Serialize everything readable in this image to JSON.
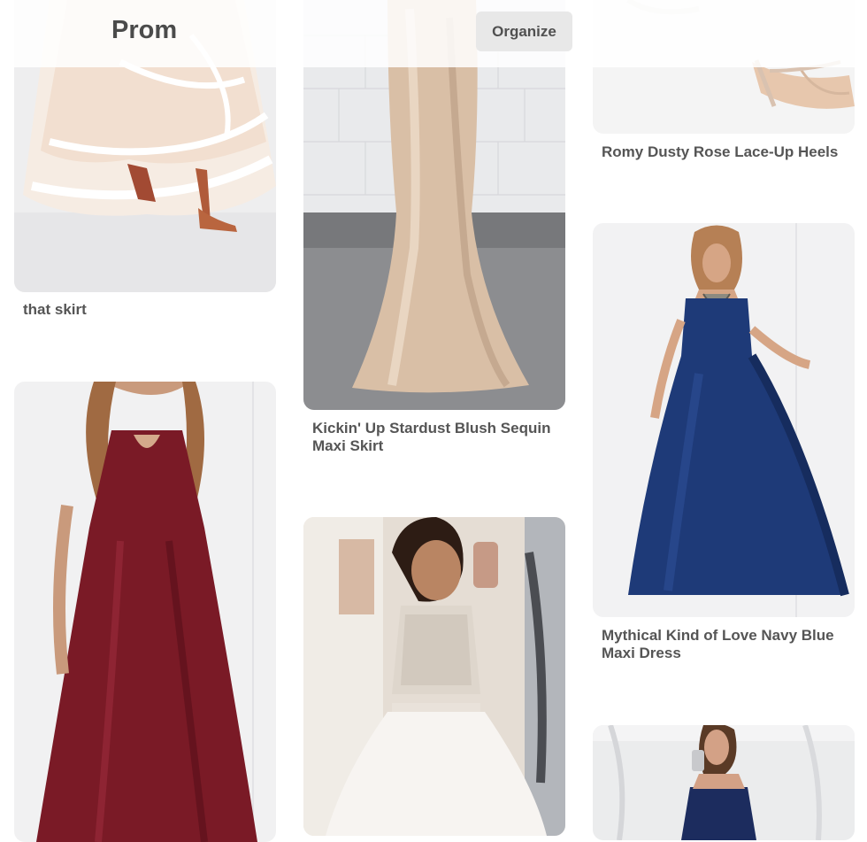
{
  "header": {
    "board_title": "Prom",
    "organize_label": "Organize"
  },
  "pins": [
    {
      "title": "that skirt",
      "image": "white-tulle-skirt-with-heels"
    },
    {
      "title": "Kickin' Up Stardust Blush Sequin Maxi Skirt",
      "image": "blush-sequin-mermaid-skirt"
    },
    {
      "title": "Romy Dusty Rose Lace-Up Heels",
      "image": "nude-strappy-heels"
    },
    {
      "title": "",
      "image": "burgundy-halter-maxi-dress"
    },
    {
      "title": "",
      "image": "two-piece-beaded-prom-dress-selfie"
    },
    {
      "title": "Mythical Kind of Love Navy Blue Maxi Dress",
      "image": "navy-blue-maxi-dress"
    },
    {
      "title": "",
      "image": "navy-strapless-dress-selfie"
    }
  ],
  "colors": {
    "text": "#555555",
    "button_bg": "#e8e8e8",
    "navy": "#1e3a78",
    "burgundy": "#7a1a26",
    "sequin": "#d9bfa6"
  }
}
